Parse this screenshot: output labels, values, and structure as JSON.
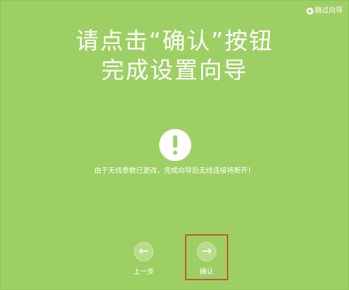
{
  "header": {
    "skip_label": "跳过向导",
    "skip_icon": "skip-icon"
  },
  "main": {
    "title_line_1": "请点击“确认”按钮",
    "title_line_2": "完成设置向导",
    "warning_icon": "warning-icon",
    "notice": "由于无线参数已更改，完成向导后无线连接将断开！"
  },
  "footer": {
    "prev_label": "上一步",
    "prev_icon": "arrow-left-icon",
    "confirm_label": "确认",
    "confirm_icon": "arrow-right-icon"
  },
  "colors": {
    "background": "#9ecf64",
    "text": "#ffffff",
    "highlight": "#c55a2c"
  }
}
